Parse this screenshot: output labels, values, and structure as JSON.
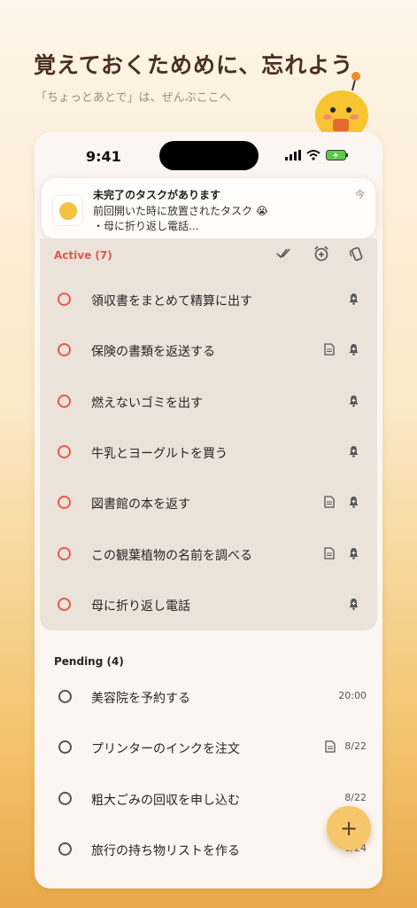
{
  "headline": "覚えておくためめに、忘れよう",
  "subline": "「ちょっとあとで」は、ぜんぶここへ",
  "status": {
    "time": "9:41"
  },
  "notification": {
    "title": "未完了のタスクがあります",
    "line1": "前回開いた時に放置されたタスク 😭",
    "line2": "・母に折り返し電話...",
    "time": "今"
  },
  "active": {
    "header": "Active (7)",
    "items": [
      {
        "label": "領収書をまとめて精算に出す",
        "doc": false
      },
      {
        "label": "保険の書類を返送する",
        "doc": true
      },
      {
        "label": "燃えないゴミを出す",
        "doc": false
      },
      {
        "label": "牛乳とヨーグルトを買う",
        "doc": false
      },
      {
        "label": "図書館の本を返す",
        "doc": true
      },
      {
        "label": "この観葉植物の名前を調べる",
        "doc": true
      },
      {
        "label": "母に折り返し電話",
        "doc": false
      }
    ]
  },
  "pending": {
    "header": "Pending (4)",
    "items": [
      {
        "label": "美容院を予約する",
        "meta": "20:00",
        "doc": false
      },
      {
        "label": "プリンターのインクを注文",
        "meta": "8/22",
        "doc": true
      },
      {
        "label": "粗大ごみの回収を申し込む",
        "meta": "8/22",
        "doc": false
      },
      {
        "label": "旅行の持ち物リストを作る",
        "meta": "8/24",
        "doc": false
      }
    ]
  },
  "fab": {
    "label": "+"
  },
  "colors": {
    "active_header": "#e0584c",
    "accent": "#f5c76a"
  }
}
